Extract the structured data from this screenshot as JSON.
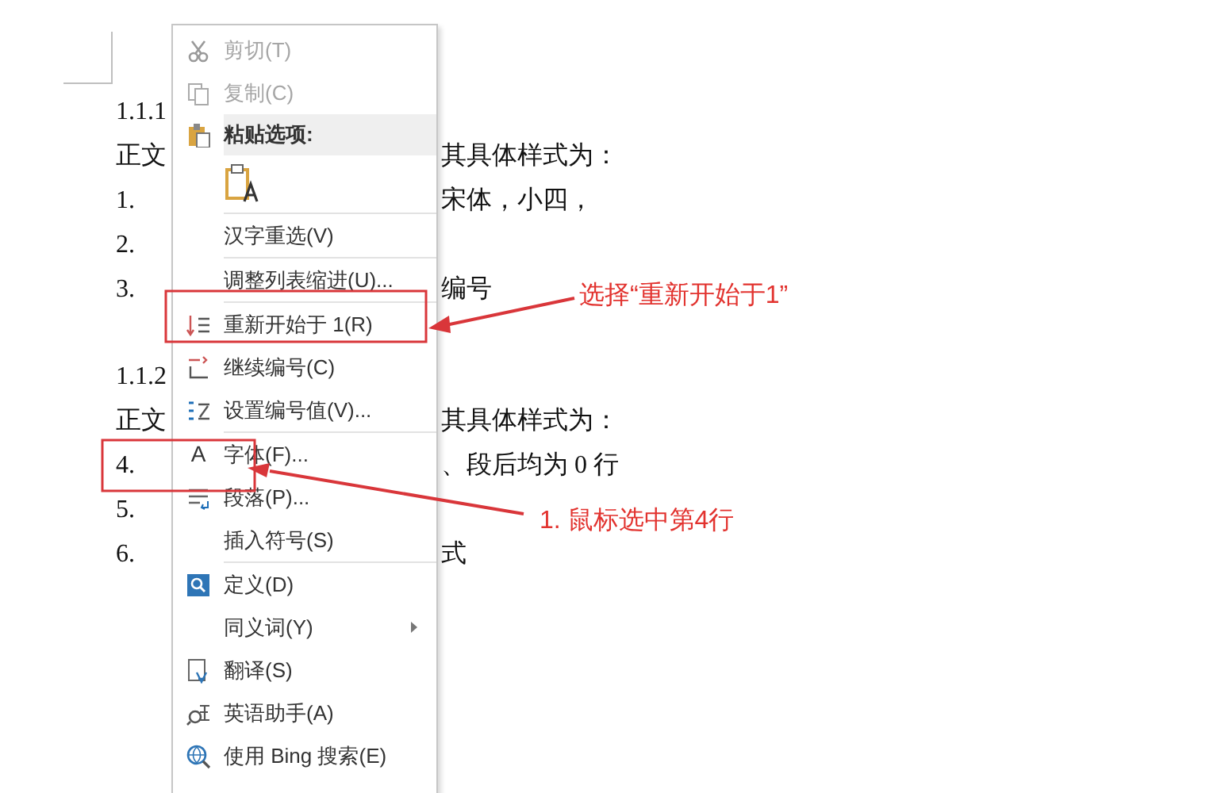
{
  "document": {
    "sections": [
      {
        "lines": [
          {
            "number": "1.1.1"
          },
          {
            "number": "正文",
            "tail": "其具体样式为："
          },
          {
            "number": "1.",
            "tail": "宋体，小四，"
          },
          {
            "number": "2."
          },
          {
            "number": "3.",
            "tail": "编号"
          }
        ]
      },
      {
        "lines": [
          {
            "number": "1.1.2"
          },
          {
            "number": "正文",
            "tail": "其具体样式为："
          },
          {
            "number": "4.",
            "tail": "、段后均为 0 行"
          },
          {
            "number": "5."
          },
          {
            "number": "6.",
            "tail": "式"
          }
        ]
      }
    ]
  },
  "context_menu": {
    "groups": [
      [
        {
          "kind": "item",
          "label": "剪切(T)",
          "disabled": true
        },
        {
          "kind": "item",
          "label": "复制(C)",
          "disabled": true
        },
        {
          "kind": "header",
          "label": "粘贴选项:"
        },
        {
          "kind": "paste"
        }
      ],
      [
        {
          "kind": "item",
          "label": "汉字重选(V)",
          "disabled": false
        }
      ],
      [
        {
          "kind": "item",
          "label": "调整列表缩进(U)...",
          "disabled": false
        }
      ],
      [
        {
          "kind": "item",
          "label": "重新开始于 1(R)",
          "disabled": false
        },
        {
          "kind": "item",
          "label": "继续编号(C)",
          "disabled": false
        },
        {
          "kind": "item",
          "label": "设置编号值(V)...",
          "disabled": false
        }
      ],
      [
        {
          "kind": "item",
          "label": "字体(F)...",
          "disabled": false,
          "icon_char": "A"
        },
        {
          "kind": "item",
          "label": "段落(P)...",
          "disabled": false
        },
        {
          "kind": "item",
          "label": "插入符号(S)",
          "disabled": false
        }
      ],
      [
        {
          "kind": "item",
          "label": "定义(D)",
          "disabled": false
        },
        {
          "kind": "item",
          "label": "同义词(Y)",
          "disabled": false,
          "submenu": true
        },
        {
          "kind": "item",
          "label": "翻译(S)",
          "disabled": false
        },
        {
          "kind": "item",
          "label": "英语助手(A)",
          "disabled": false
        },
        {
          "kind": "item",
          "label": "使用 Bing 搜索(E)",
          "disabled": false
        }
      ]
    ]
  },
  "annotations": [
    {
      "text": "选择“重新开始于1”"
    },
    {
      "text": "1. 鼠标选中第4行"
    }
  ]
}
